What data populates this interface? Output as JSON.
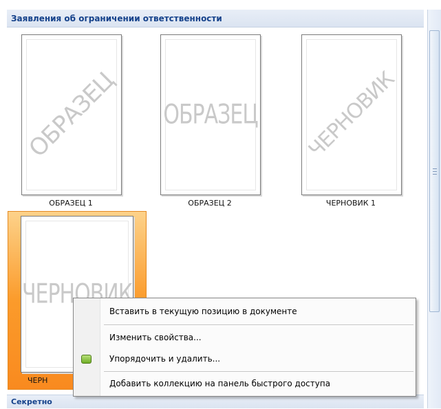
{
  "gallery": {
    "section_title": "Заявления об ограничении ответственности",
    "next_section_title": "Секретно",
    "items": [
      {
        "caption": "ОБРАЗЕЦ 1",
        "watermark": "ОБРАЗЕЦ",
        "orientation": "diagonal"
      },
      {
        "caption": "ОБРАЗЕЦ 2",
        "watermark": "ОБРАЗЕЦ",
        "orientation": "horizontal"
      },
      {
        "caption": "ЧЕРНОВИК 1",
        "watermark": "ЧЕРНОВИК",
        "orientation": "diagonal"
      },
      {
        "caption": "ЧЕРН",
        "watermark": "ЧЕРНОВИК",
        "orientation": "horizontal",
        "selected": true
      }
    ],
    "selected_color": "#f98a1f"
  },
  "context_menu": {
    "items": [
      {
        "label": "Вставить в текущую позицию в документе"
      },
      {
        "label": "Изменить свойства..."
      },
      {
        "label": "Упорядочить и удалить...",
        "icon": "organizer-icon"
      },
      {
        "label": "Добавить коллекцию на панель быстрого доступа"
      }
    ]
  }
}
